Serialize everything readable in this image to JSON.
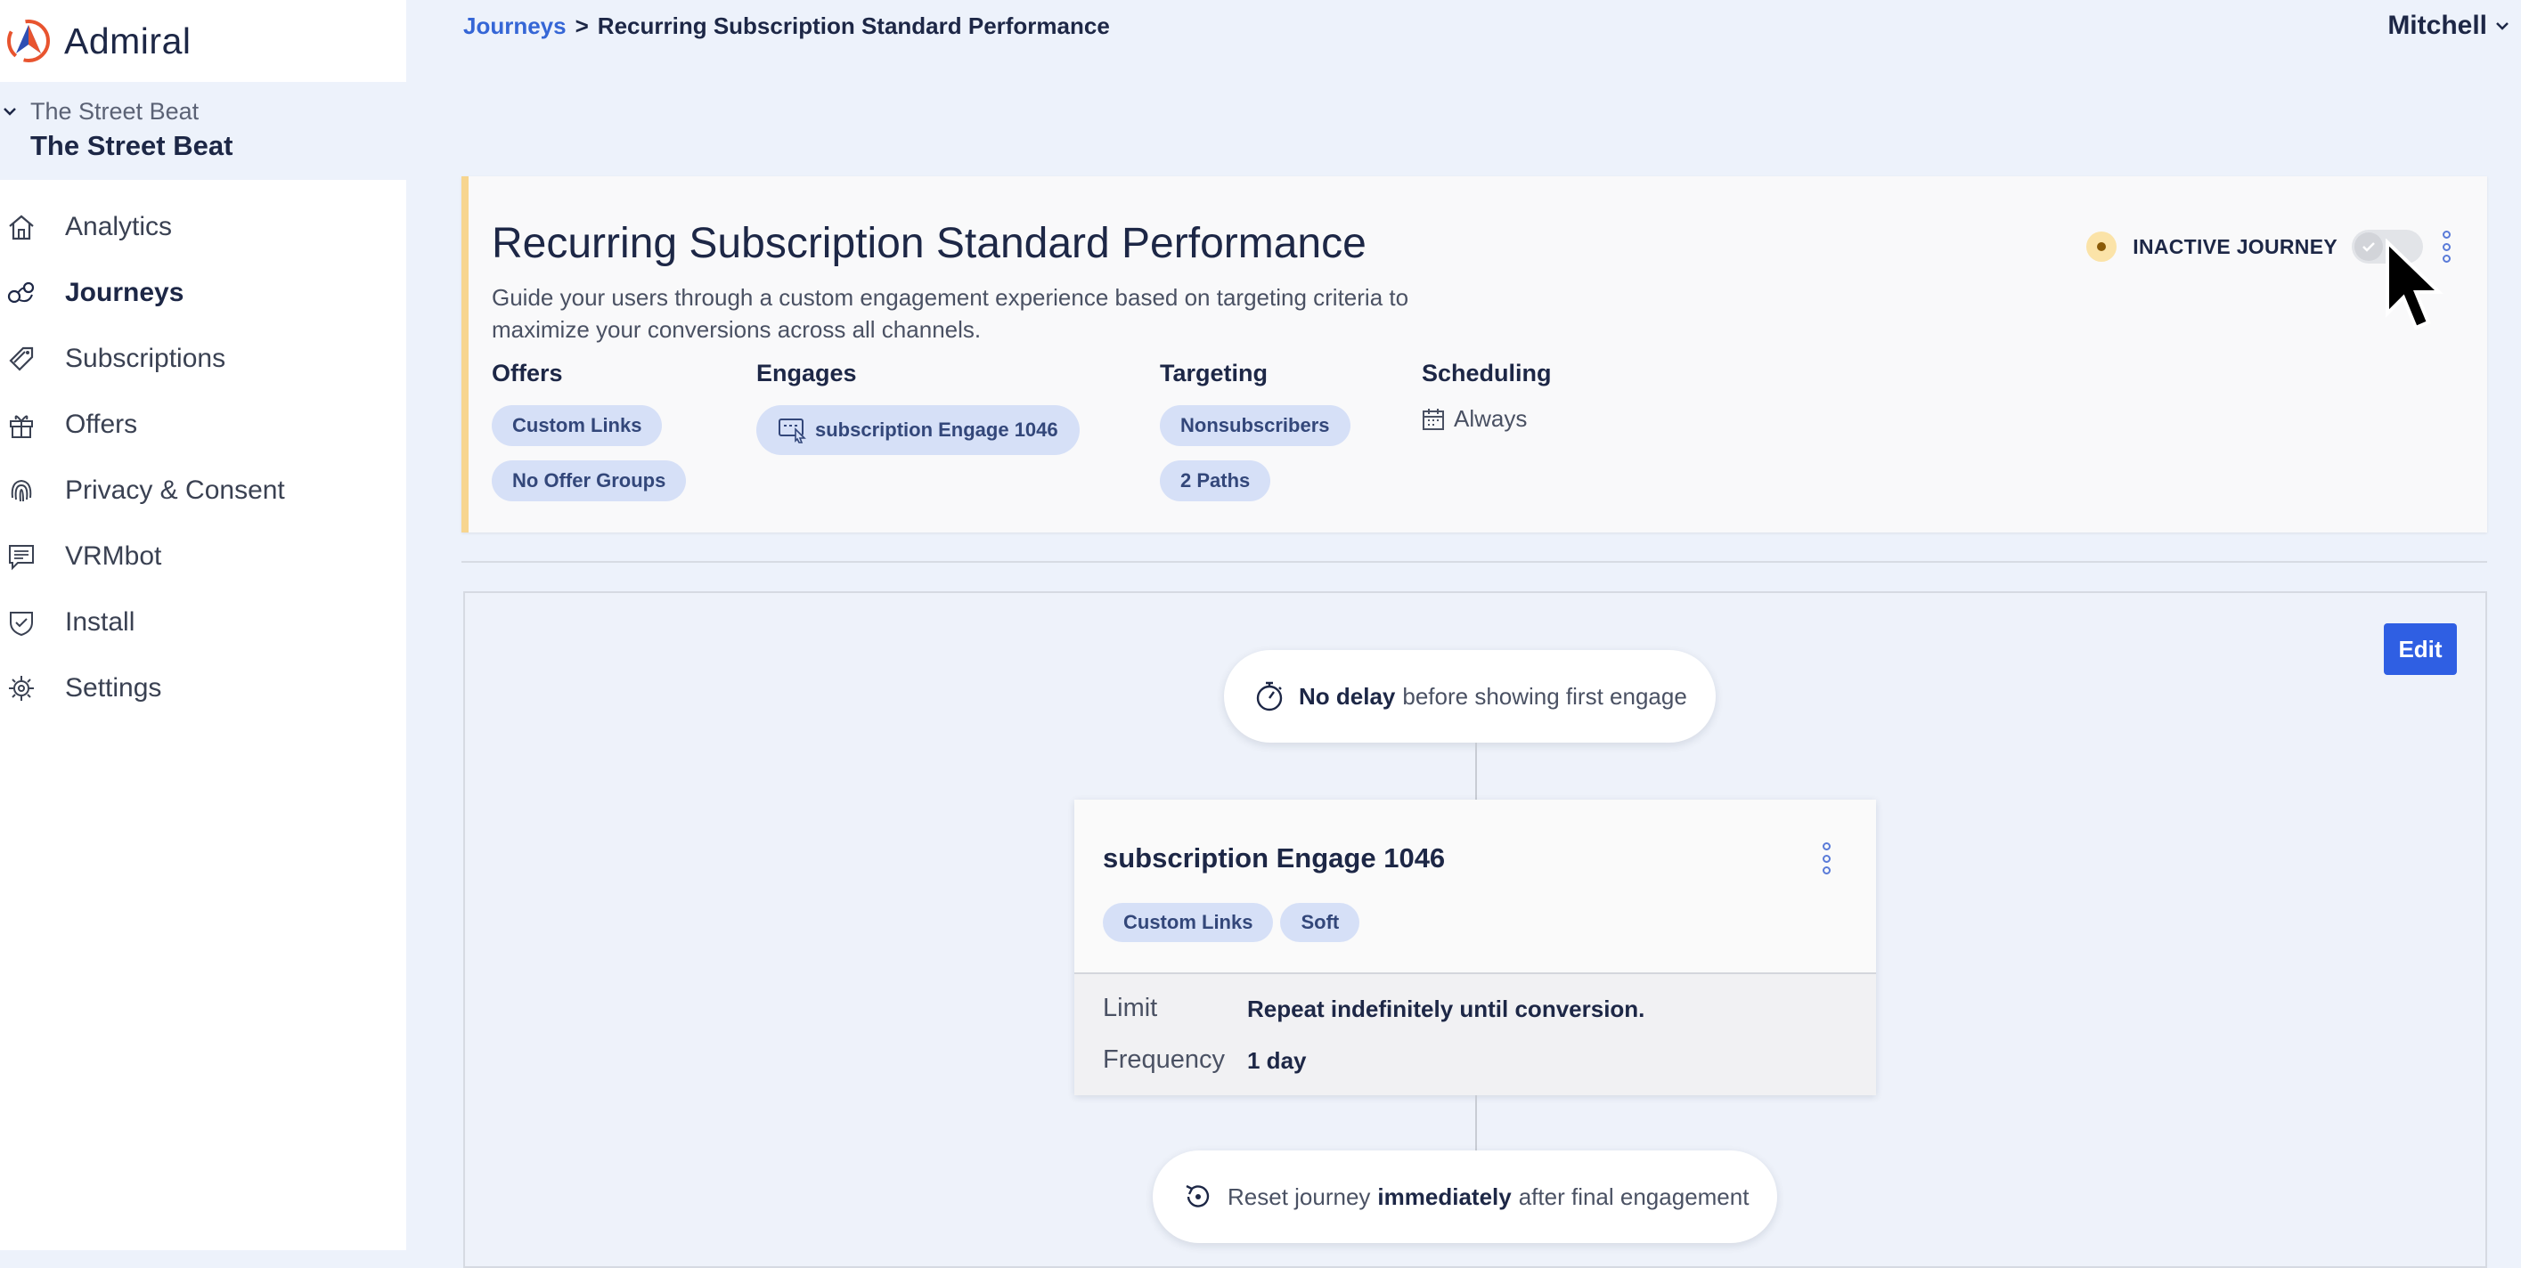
{
  "app": {
    "logo_text": "Admiral"
  },
  "org": {
    "subtitle": "The Street Beat",
    "title": "The Street Beat"
  },
  "sidebar": {
    "items": [
      {
        "label": "Analytics",
        "icon": "home-icon",
        "active": false
      },
      {
        "label": "Journeys",
        "icon": "journeys-icon",
        "active": true
      },
      {
        "label": "Subscriptions",
        "icon": "tag-icon",
        "active": false
      },
      {
        "label": "Offers",
        "icon": "gift-icon",
        "active": false
      },
      {
        "label": "Privacy & Consent",
        "icon": "fingerprint-icon",
        "active": false
      },
      {
        "label": "VRMbot",
        "icon": "chat-icon",
        "active": false
      },
      {
        "label": "Install",
        "icon": "shield-icon",
        "active": false
      },
      {
        "label": "Settings",
        "icon": "gear-icon",
        "active": false
      }
    ]
  },
  "breadcrumb": {
    "root": "Journeys",
    "separator": ">",
    "current": "Recurring Subscription Standard Performance"
  },
  "user": {
    "name": "Mitchell"
  },
  "journey": {
    "title": "Recurring Subscription Standard Performance",
    "description": "Guide your users through a custom engagement experience based on targeting criteria to maximize your conversions across all channels.",
    "status_label": "INACTIVE JOURNEY",
    "active": false,
    "offers": {
      "title": "Offers",
      "chips": [
        "Custom Links",
        "No Offer Groups"
      ]
    },
    "engages": {
      "title": "Engages",
      "chips": [
        "subscription Engage 1046"
      ]
    },
    "targeting": {
      "title": "Targeting",
      "chips": [
        "Nonsubscribers",
        "2 Paths"
      ]
    },
    "scheduling": {
      "title": "Scheduling",
      "value": "Always"
    }
  },
  "flow": {
    "edit_label": "Edit",
    "delay": {
      "bold": "No delay",
      "rest": "before showing first engage"
    },
    "engage": {
      "title": "subscription Engage 1046",
      "chips": [
        "Custom Links",
        "Soft"
      ],
      "limit_label": "Limit",
      "limit_value": "Repeat indefinitely until conversion.",
      "frequency_label": "Frequency",
      "frequency_value": "1 day"
    },
    "reset": {
      "before": "Reset journey",
      "bold": "immediately",
      "after": "after final engagement"
    }
  },
  "colors": {
    "accent": "#2f5fe3",
    "link": "#3566d6",
    "chip_bg": "#d6e0f7",
    "status_warning": "#fbe3a8",
    "card_border": "#f7d58f"
  }
}
